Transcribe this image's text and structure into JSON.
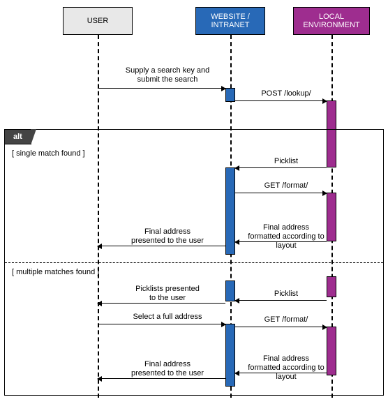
{
  "participants": {
    "user": "USER",
    "website": "WEBSITE / INTRANET",
    "local": "LOCAL ENVIRONMENT"
  },
  "fragment": {
    "operator": "alt",
    "guard1": "[ single match found ]",
    "guard2": "[ multiple matches found ]"
  },
  "messages": {
    "m1": "Supply a search key and submit the search",
    "m2": "POST /lookup/",
    "m3": "Picklist",
    "m4": "GET /format/",
    "m5": "Final address formatted according to layout",
    "m6": "Final address presented to the user",
    "m7": "Picklists presented to the user",
    "m8": "Picklist",
    "m9": "Select a full address",
    "m10": "GET /format/",
    "m11": "Final address formatted according to layout",
    "m12": "Final address presented to the user"
  },
  "chart_data": {
    "type": "sequence_diagram",
    "participants": [
      "USER",
      "WEBSITE / INTRANET",
      "LOCAL ENVIRONMENT"
    ],
    "interactions": [
      {
        "from": "USER",
        "to": "WEBSITE / INTRANET",
        "label": "Supply a search key and submit the search"
      },
      {
        "from": "WEBSITE / INTRANET",
        "to": "LOCAL ENVIRONMENT",
        "label": "POST /lookup/"
      }
    ],
    "fragment": {
      "type": "alt",
      "operands": [
        {
          "guard": "single match found",
          "interactions": [
            {
              "from": "LOCAL ENVIRONMENT",
              "to": "WEBSITE / INTRANET",
              "label": "Picklist"
            },
            {
              "from": "WEBSITE / INTRANET",
              "to": "LOCAL ENVIRONMENT",
              "label": "GET /format/"
            },
            {
              "from": "LOCAL ENVIRONMENT",
              "to": "WEBSITE / INTRANET",
              "label": "Final address formatted according to layout"
            },
            {
              "from": "WEBSITE / INTRANET",
              "to": "USER",
              "label": "Final address presented to the user"
            }
          ]
        },
        {
          "guard": "multiple matches found",
          "interactions": [
            {
              "from": "LOCAL ENVIRONMENT",
              "to": "WEBSITE / INTRANET",
              "label": "Picklist"
            },
            {
              "from": "WEBSITE / INTRANET",
              "to": "USER",
              "label": "Picklists presented to the user"
            },
            {
              "from": "USER",
              "to": "WEBSITE / INTRANET",
              "label": "Select a full address"
            },
            {
              "from": "WEBSITE / INTRANET",
              "to": "LOCAL ENVIRONMENT",
              "label": "GET /format/"
            },
            {
              "from": "LOCAL ENVIRONMENT",
              "to": "WEBSITE / INTRANET",
              "label": "Final address formatted according to layout"
            },
            {
              "from": "WEBSITE / INTRANET",
              "to": "USER",
              "label": "Final address presented to the user"
            }
          ]
        }
      ]
    }
  }
}
